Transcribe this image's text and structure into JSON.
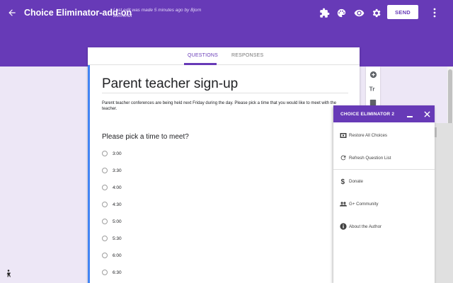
{
  "header": {
    "title": "Choice Eliminator-add-on",
    "last_edit": "Last edit was made 5 minutes ago by Bjorn Behrendt",
    "send_label": "SEND",
    "icons": [
      "back-arrow-icon",
      "puzzle-icon",
      "palette-icon",
      "eye-icon",
      "gear-icon",
      "more-vert-icon"
    ]
  },
  "tabs": {
    "questions": "QUESTIONS",
    "responses": "RESPONSES"
  },
  "form": {
    "title": "Parent teacher sign-up",
    "description": "Parent teacher conferences are being held next Friday during the day.  Please pick a time that you would like to meet with the teacher.",
    "question": "Please pick a time to meet?",
    "options": [
      "3:00",
      "3:30",
      "4:00",
      "4:30",
      "5:00",
      "5:30",
      "6:00",
      "6:30"
    ]
  },
  "panel": {
    "title": "CHOICE ELIMINATOR 2",
    "items": [
      {
        "label": "Restore All Choices",
        "icon": "restore-icon"
      },
      {
        "label": "Refresh Question List",
        "icon": "refresh-icon"
      },
      {
        "label": "Donate",
        "icon": "dollar-icon"
      },
      {
        "label": "G+ Community",
        "icon": "community-icon"
      },
      {
        "label": "About the Author",
        "icon": "info-icon"
      }
    ]
  },
  "colors": {
    "primary": "#673ab7",
    "background": "#ede7f6",
    "accent": "#4285f4"
  }
}
